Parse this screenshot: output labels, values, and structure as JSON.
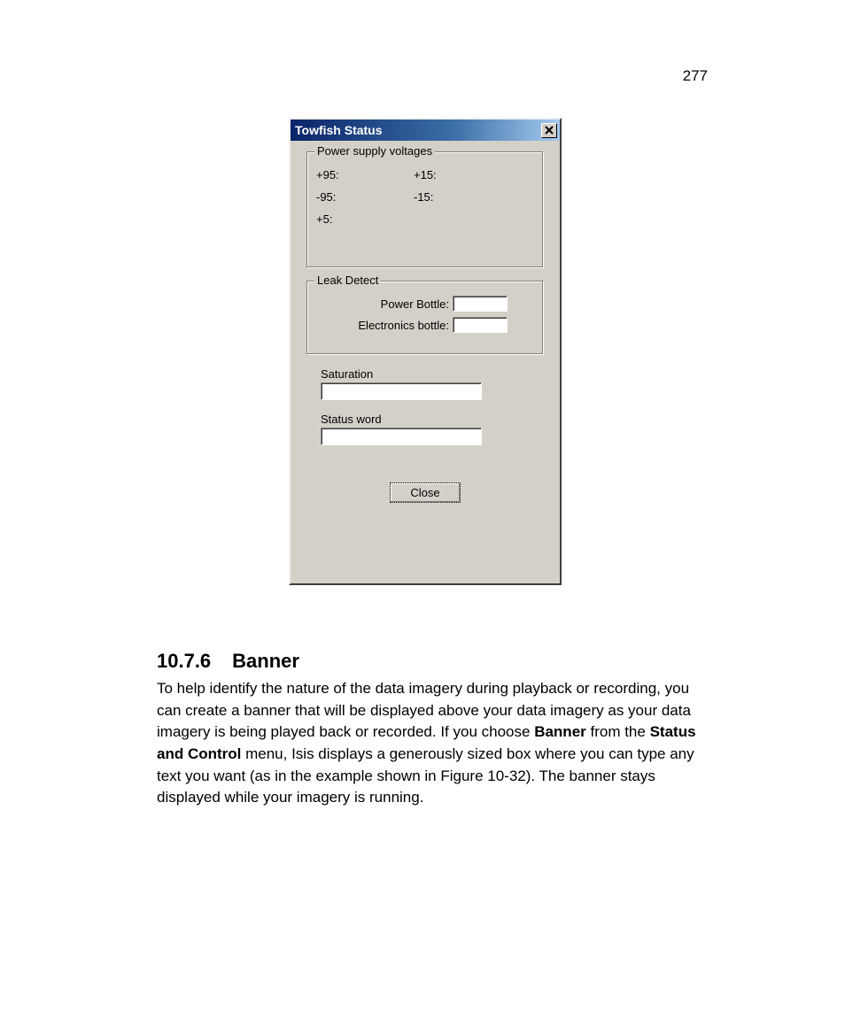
{
  "page_number": "277",
  "dialog": {
    "title": "Towfish Status",
    "voltages": {
      "legend": "Power supply voltages",
      "rows": [
        {
          "left": "+95:",
          "right": "+15:"
        },
        {
          "left": " -95:",
          "right": " -15:"
        },
        {
          "left": "  +5:",
          "right": ""
        }
      ]
    },
    "leak": {
      "legend": "Leak Detect",
      "power_label": "Power Bottle:",
      "electronics_label": "Electronics bottle:"
    },
    "saturation_label": "Saturation",
    "statusword_label": "Status word",
    "close_label": "Close"
  },
  "section": {
    "number": "10.7.6",
    "title": "Banner",
    "body_pre": "To help identify the nature of the data imagery during playback or recording, you can create a banner that will be displayed above your data imagery as your data imagery is being played back or recorded. If you choose ",
    "bold1": "Banner",
    "body_mid": " from the ",
    "bold2": "Status and Control",
    "body_post": " menu, Isis displays a generously sized box where you can type any text you want (as in the example shown in Figure 10-32). The banner stays displayed while your imagery is running."
  }
}
